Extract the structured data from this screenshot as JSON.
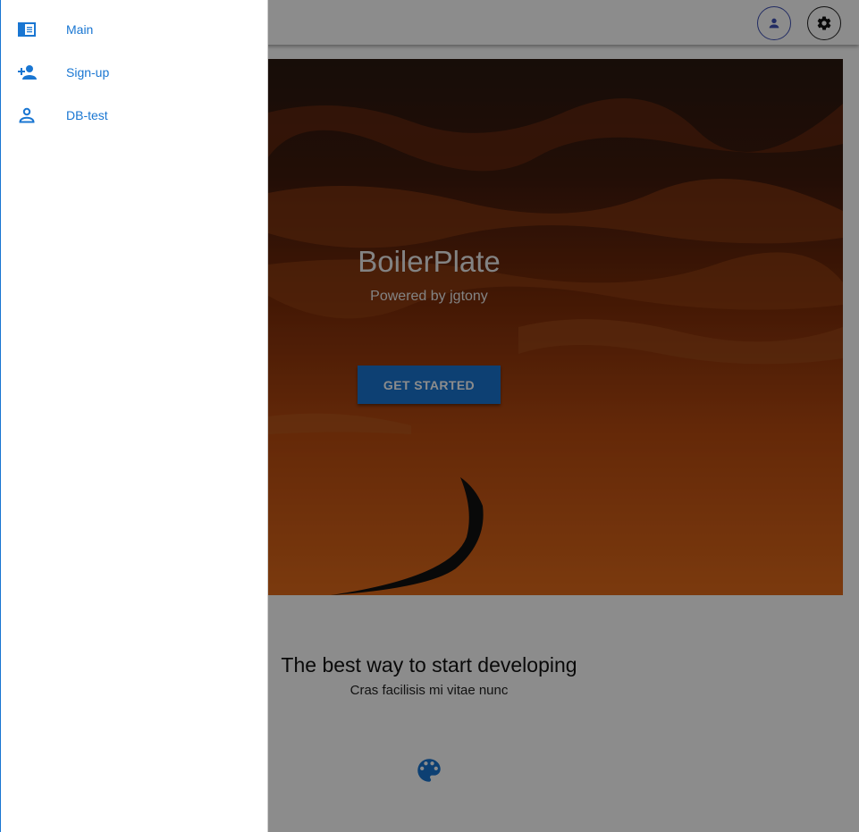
{
  "colors": {
    "accent": "#1976d2",
    "topbar": "#ffffff",
    "scrim": "rgba(0,0,0,0.45)"
  },
  "toolbar": {
    "account_icon": "account-icon",
    "settings_icon": "gear-icon"
  },
  "hero": {
    "title": "BoilerPlate",
    "subtitle": "Powered by jgtony",
    "button_label": "GET STARTED"
  },
  "section": {
    "title": "The best way to start developing",
    "subtitle": "Cras facilisis mi vitae nunc",
    "icon": "palette-icon"
  },
  "drawer": {
    "items": [
      {
        "label": "Main",
        "icon": "main-icon"
      },
      {
        "label": "Sign-up",
        "icon": "person-add-icon"
      },
      {
        "label": "DB-test",
        "icon": "person-outline-icon"
      }
    ]
  }
}
